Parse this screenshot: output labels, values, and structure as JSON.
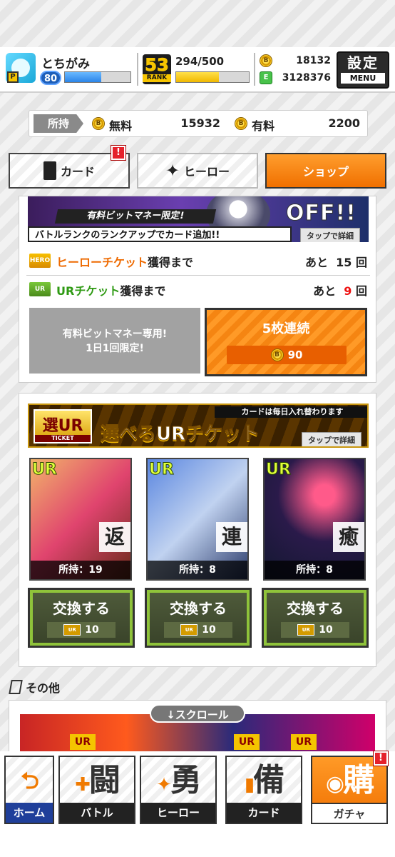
{
  "player": {
    "name": "とちがみ",
    "level": "80",
    "exp_fraction": 0.55,
    "p_badge": "P"
  },
  "rank": {
    "value": "53",
    "label": "RANK",
    "points": "294/500",
    "fraction": 0.588
  },
  "currency": {
    "coin_icon": "B",
    "bit_money": "18132",
    "green_icon": "E",
    "energy": "3128376"
  },
  "menu": {
    "title": "設定",
    "sub": "MENU"
  },
  "wallet": {
    "label": "所持",
    "free_label": "無料",
    "free_value": "15932",
    "paid_label": "有料",
    "paid_value": "2200"
  },
  "tabs": {
    "card": "カード",
    "hero": "ヒーロー",
    "shop": "ショップ",
    "alert": "!"
  },
  "banner1": {
    "off_text": "OFF!!",
    "ribbon1": "有料ビットマネー限定!",
    "ribbon2": "バトルランクのランクアップでカード追加!!",
    "tap": "タップで詳細"
  },
  "tickets": [
    {
      "icon": "HERO",
      "name": "ヒーローチケット",
      "suffix": "獲得まで",
      "remain_prefix": "あと",
      "remain": "15",
      "unit": "回"
    },
    {
      "icon": "UR",
      "name": "URチケット",
      "suffix": "獲得まで",
      "remain_prefix": "あと",
      "remain": "9",
      "unit": "回"
    }
  ],
  "promo": {
    "line1": "有料ビットマネー専用!",
    "line2": "1日1回限定!"
  },
  "pull": {
    "label": "5枚連続",
    "cost": "90",
    "coin_icon": "B"
  },
  "ur_banner": {
    "note": "カードは毎日入れ替わります",
    "logo": "選UR",
    "logo_sub": "TICKET",
    "title": "選べるURチケット",
    "tap": "タップで詳細"
  },
  "ur_cards": [
    {
      "tag": "UR",
      "kanji": "返",
      "owned": "所持：19",
      "exchange": "交換する",
      "cost": "10",
      "ticket": "UR"
    },
    {
      "tag": "UR",
      "kanji": "連",
      "owned": "所持：8",
      "exchange": "交換する",
      "cost": "10",
      "ticket": "UR"
    },
    {
      "tag": "UR",
      "kanji": "癒",
      "owned": "所持：8",
      "exchange": "交換する",
      "cost": "10",
      "ticket": "UR"
    }
  ],
  "others": {
    "title": "その他",
    "scroll_hint": "↓スクロール",
    "banner_marks": [
      "UR",
      "UR",
      "UR"
    ]
  },
  "nav": {
    "home": {
      "label": "ホーム"
    },
    "battle": {
      "label": "バトル",
      "glyph": "闘"
    },
    "hero": {
      "label": "ヒーロー",
      "glyph": "勇"
    },
    "card": {
      "label": "カード",
      "glyph": "備"
    },
    "gacha": {
      "label": "ガチャ",
      "glyph": "購",
      "alert": "!"
    }
  },
  "colors": {
    "accent": "#f58512",
    "ur_green": "#8fc33a",
    "alert_red": "#e5212b",
    "level_blue": "#2b84e8",
    "rank_yellow": "#f0b800"
  }
}
